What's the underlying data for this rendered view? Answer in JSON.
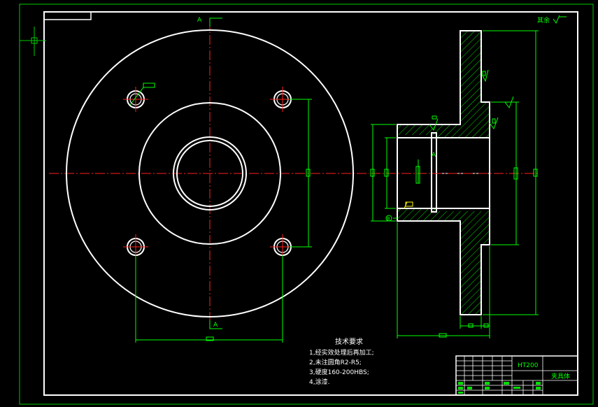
{
  "drawing": {
    "section_marker": "A",
    "roughness_note": "其余",
    "datum_label": "B",
    "material": "HT200",
    "part_name": "夹具体"
  },
  "tech_requirements": {
    "title": "技术要求",
    "items": [
      "1,经实效处理后再加工;",
      "2,未注圆角R2-R5;",
      "3,硬度160-200HBS;",
      "4,涂漆."
    ]
  },
  "colors": {
    "background": "#000000",
    "outline": "#ffffff",
    "dimension": "#00ff00",
    "centerline": "#ff2020",
    "hatch": "#00dd00",
    "annotation": "#ffff00"
  }
}
